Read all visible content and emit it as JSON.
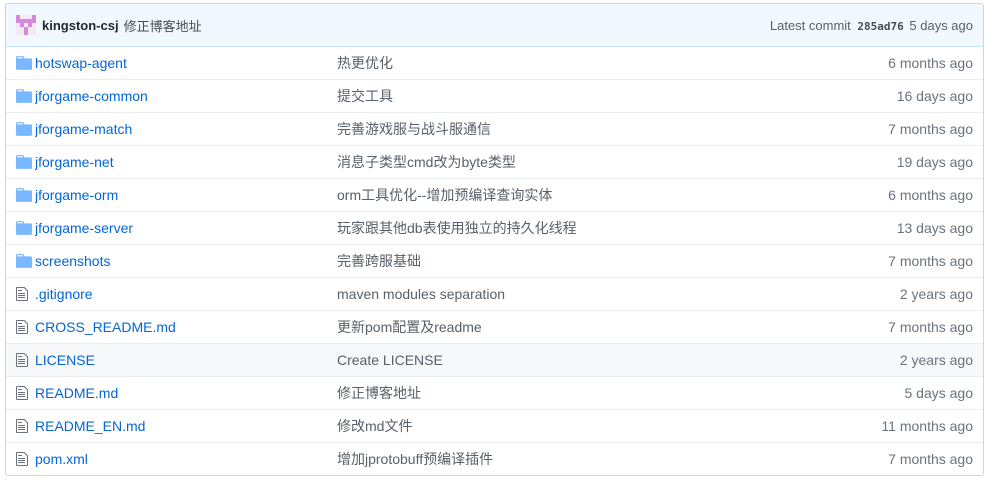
{
  "commit": {
    "author": "kingston-csj",
    "message": "修正博客地址",
    "latest_label": "Latest commit",
    "sha": "285ad76",
    "age": "5 days ago"
  },
  "colors": {
    "link": "#0366d6",
    "folder_icon": "#79b8ff",
    "file_icon": "#6a737d",
    "header_bg": "#f1f8ff"
  },
  "files": [
    {
      "type": "folder",
      "icon": "folder-icon",
      "name": "hotswap-agent",
      "message": "热更优化",
      "age": "6 months ago"
    },
    {
      "type": "folder",
      "icon": "folder-icon",
      "name": "jforgame-common",
      "message": "提交工具",
      "age": "16 days ago"
    },
    {
      "type": "folder",
      "icon": "folder-icon",
      "name": "jforgame-match",
      "message": "完善游戏服与战斗服通信",
      "age": "7 months ago"
    },
    {
      "type": "folder",
      "icon": "folder-icon",
      "name": "jforgame-net",
      "message": "消息子类型cmd改为byte类型",
      "age": "19 days ago"
    },
    {
      "type": "folder",
      "icon": "folder-icon",
      "name": "jforgame-orm",
      "message": "orm工具优化--增加预编译查询实体",
      "age": "6 months ago"
    },
    {
      "type": "folder",
      "icon": "folder-icon",
      "name": "jforgame-server",
      "message": "玩家跟其他db表使用独立的持久化线程",
      "age": "13 days ago"
    },
    {
      "type": "folder",
      "icon": "folder-icon",
      "name": "screenshots",
      "message": "完善跨服基础",
      "age": "7 months ago"
    },
    {
      "type": "file",
      "icon": "file-icon",
      "name": ".gitignore",
      "message": "maven modules separation",
      "age": "2 years ago"
    },
    {
      "type": "file",
      "icon": "file-icon",
      "name": "CROSS_README.md",
      "message": "更新pom配置及readme",
      "age": "7 months ago"
    },
    {
      "type": "file",
      "icon": "file-icon",
      "name": "LICENSE",
      "message": "Create LICENSE",
      "age": "2 years ago"
    },
    {
      "type": "file",
      "icon": "file-icon",
      "name": "README.md",
      "message": "修正博客地址",
      "age": "5 days ago"
    },
    {
      "type": "file",
      "icon": "file-icon",
      "name": "README_EN.md",
      "message": "修改md文件",
      "age": "11 months ago"
    },
    {
      "type": "file",
      "icon": "file-icon",
      "name": "pom.xml",
      "message": "增加jprotobuff预编译插件",
      "age": "7 months ago"
    }
  ]
}
